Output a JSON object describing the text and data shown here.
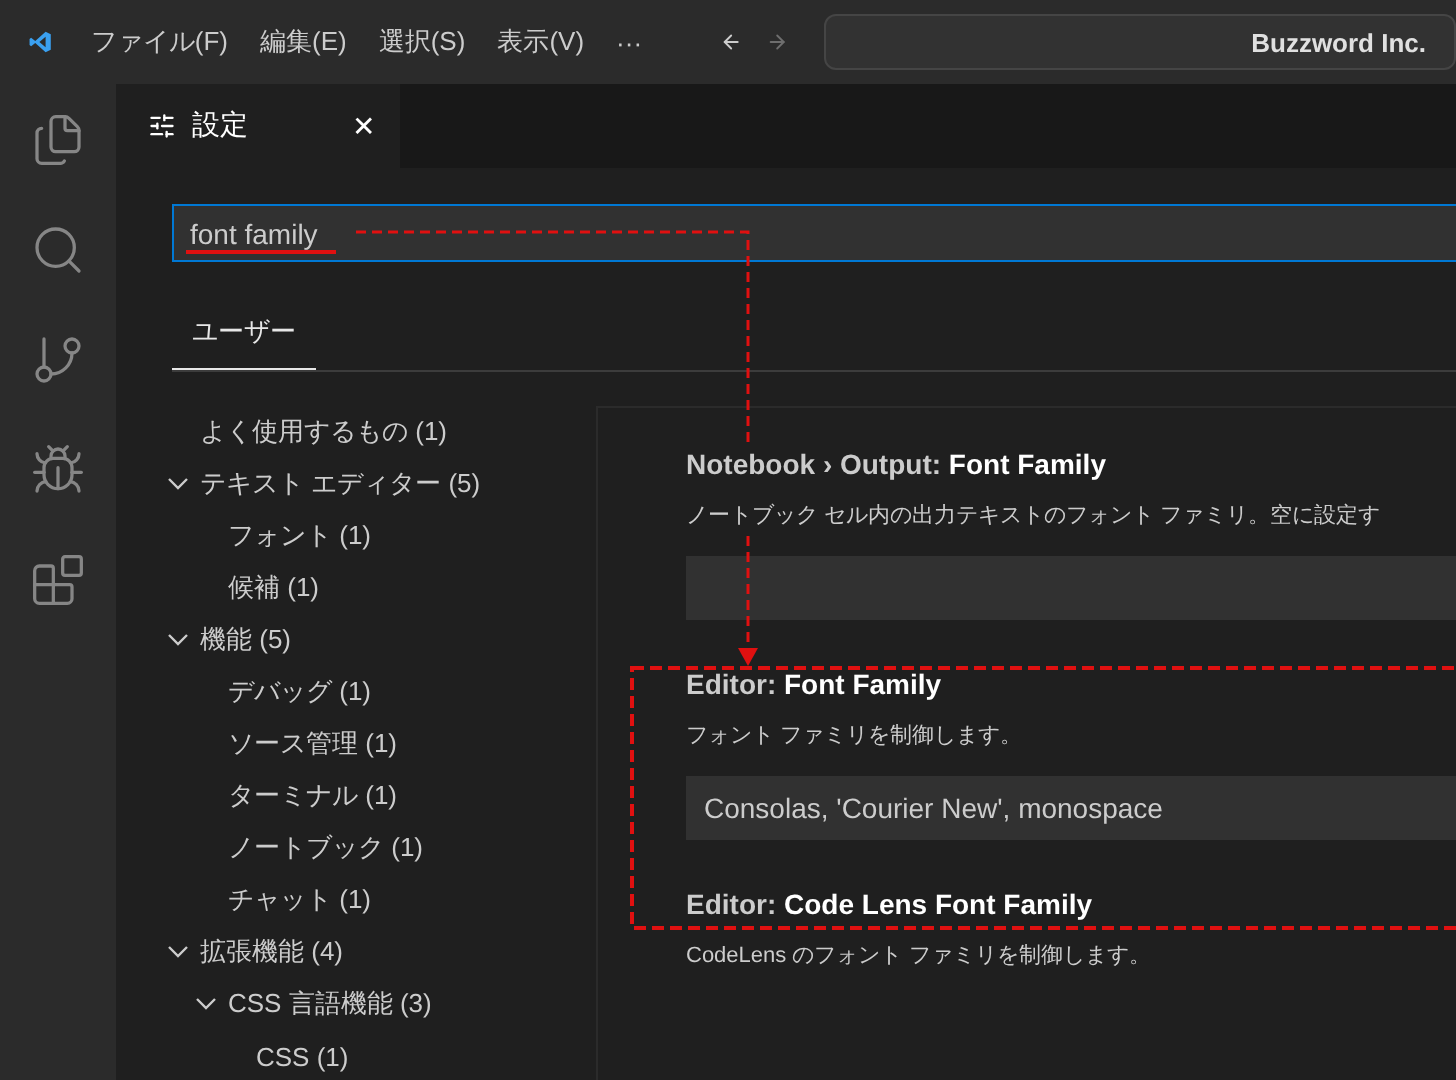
{
  "menu": [
    "ファイル(F)",
    "編集(E)",
    "選択(S)",
    "表示(V)",
    "···"
  ],
  "command_center": {
    "text": "Buzzword Inc."
  },
  "activity_bar": [
    {
      "kind": "files",
      "selected": false
    },
    {
      "kind": "search",
      "selected": false
    },
    {
      "kind": "source-control",
      "selected": false
    },
    {
      "kind": "debug",
      "selected": false
    },
    {
      "kind": "extensions",
      "selected": false
    }
  ],
  "tab": {
    "title": "設定",
    "close": "✕"
  },
  "search": {
    "value": "font family"
  },
  "scope_tabs": [
    {
      "label": "ユーザー",
      "selected": true
    }
  ],
  "tree": [
    {
      "label": "よく使用するもの (1)"
    },
    {
      "label": "テキスト エディター (5)",
      "expanded": true,
      "children": [
        {
          "label": "フォント (1)"
        },
        {
          "label": "候補 (1)"
        }
      ]
    },
    {
      "label": "機能 (5)",
      "expanded": true,
      "children": [
        {
          "label": "デバッグ (1)"
        },
        {
          "label": "ソース管理 (1)"
        },
        {
          "label": "ターミナル (1)"
        },
        {
          "label": "ノートブック (1)"
        },
        {
          "label": "チャット (1)"
        }
      ]
    },
    {
      "label": "拡張機能 (4)",
      "expanded": true,
      "children": [
        {
          "label": "CSS 言語機能 (3)",
          "expanded": true,
          "children": [
            {
              "label": "CSS (1)"
            }
          ]
        }
      ]
    }
  ],
  "settings": [
    {
      "title": "Notebook › Output: **Font Family**",
      "description": "ノートブック セル内の出力テキストのフォント ファミリ。空に設定す",
      "kind": "text"
    },
    {
      "title": "Editor: **Font Family**",
      "description": "フォント ファミリを制御します。",
      "kind": "text",
      "value": "Consolas, 'Courier New', monospace",
      "highlighted": true
    },
    {
      "title": "Editor: **Code Lens Font Family**",
      "description": "CodeLens のフォント ファミリを制御します。",
      "kind": "none"
    }
  ]
}
